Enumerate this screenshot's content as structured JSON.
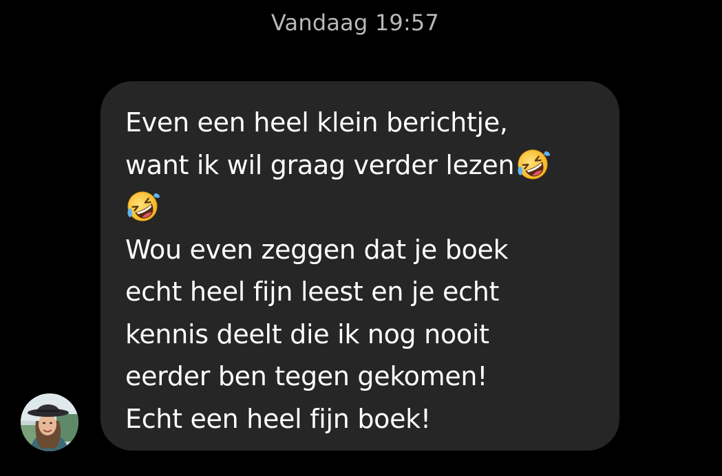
{
  "timestamp": "Vandaag 19:57",
  "message": {
    "lines": [
      "Even een heel klein berichtje,",
      "want ik wil graag verder lezen",
      "",
      "Wou even zeggen dat je boek",
      "echt heel fijn leest en je echt",
      "kennis deelt die ik nog nooit",
      "eerder ben tegen gekomen!",
      "Echt een heel fijn boek!"
    ],
    "emoji": "rolling-on-floor-laughing",
    "bubble_color": "#262626",
    "text_color": "#ffffff"
  },
  "sender": {
    "avatar": "avatar-photo"
  },
  "colors": {
    "background": "#000000",
    "timestamp": "#b9b9b9"
  }
}
